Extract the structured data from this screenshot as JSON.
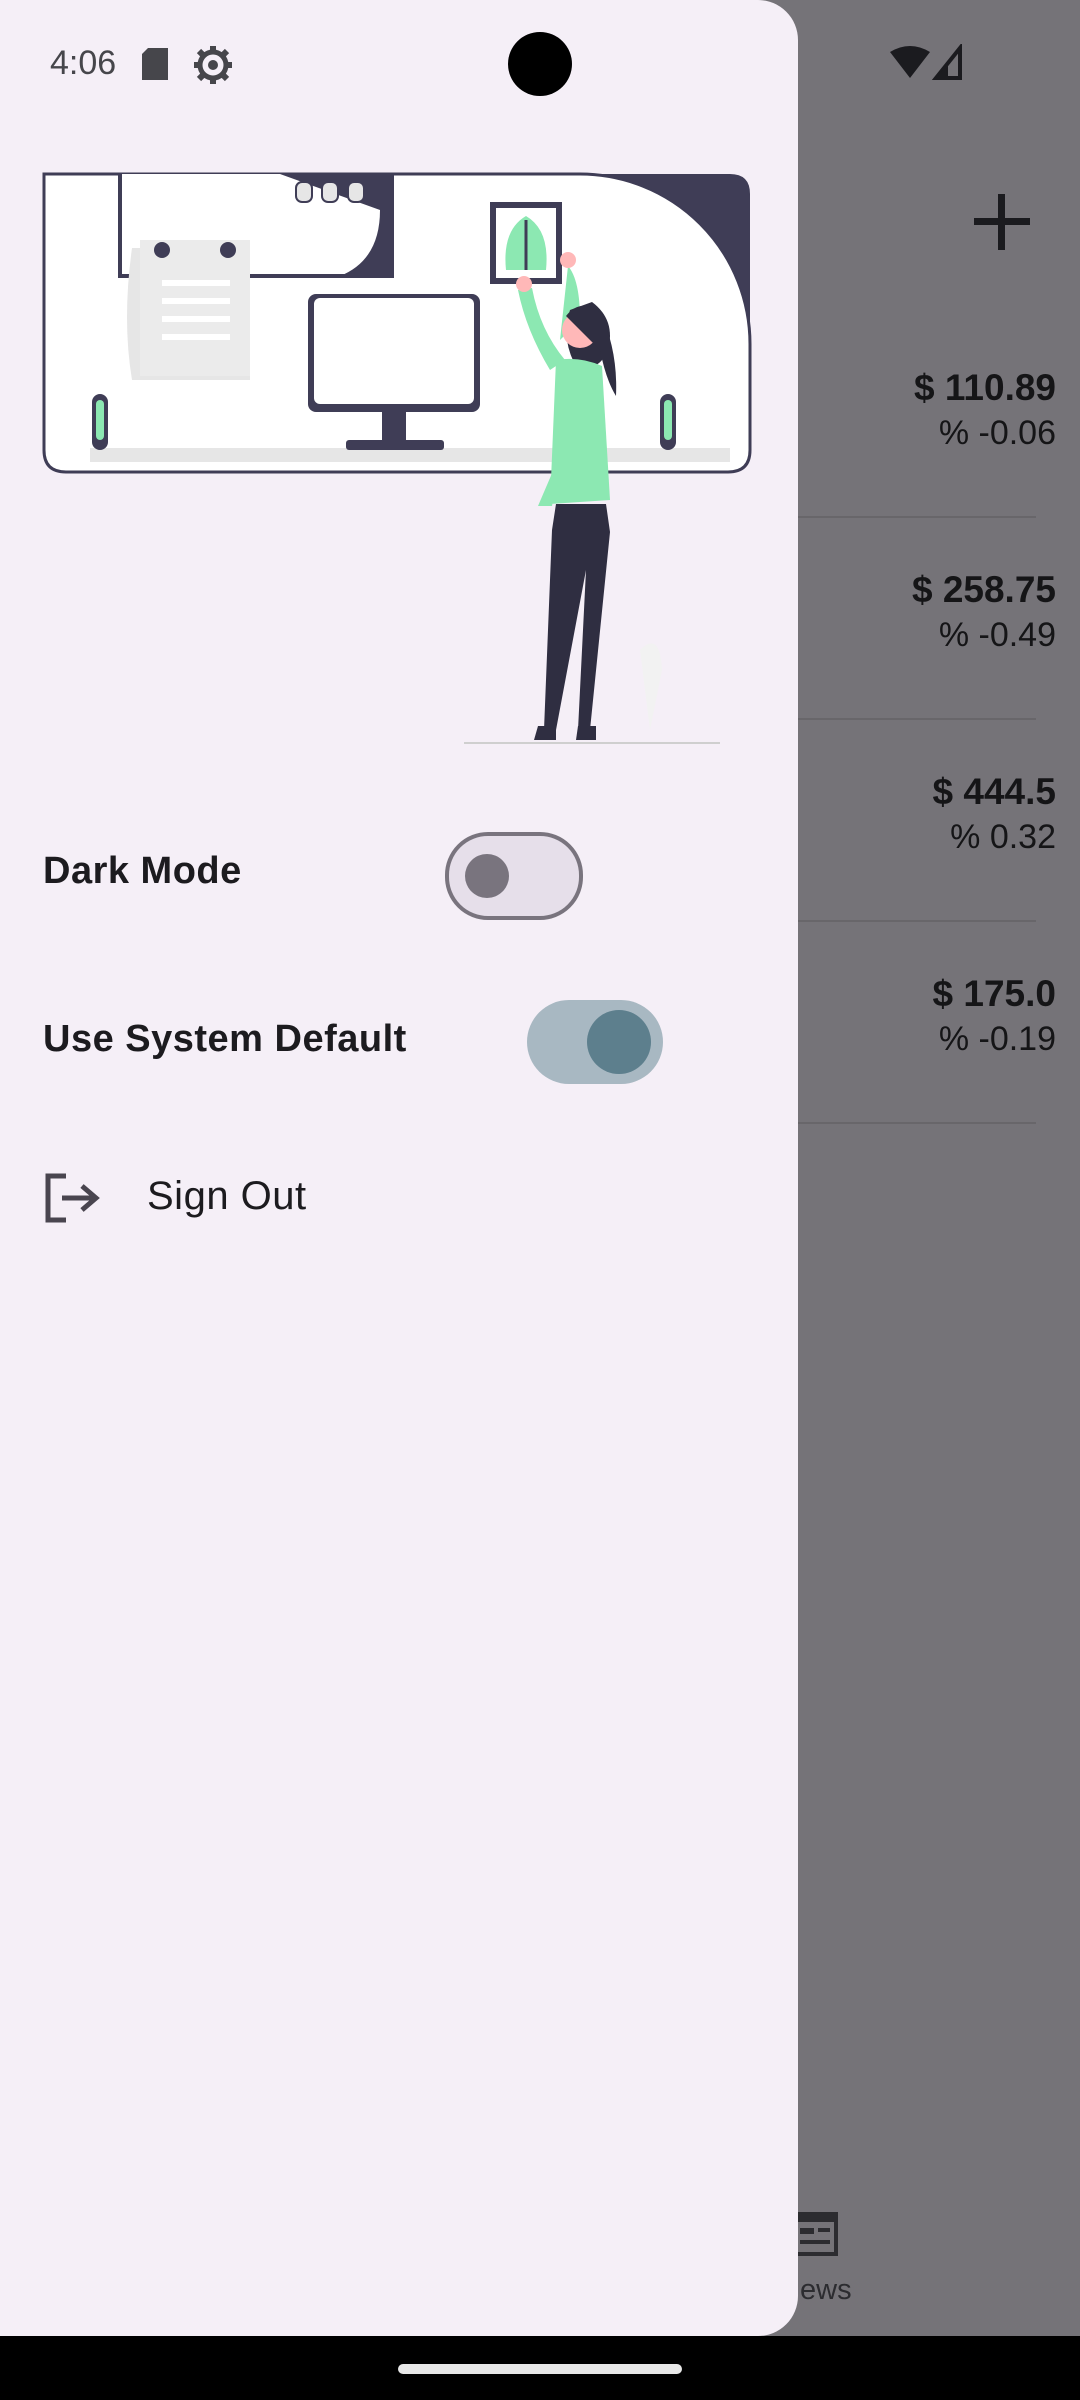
{
  "status_bar": {
    "time": "4:06"
  },
  "drawer": {
    "settings": [
      {
        "label": "Dark Mode",
        "enabled": false
      },
      {
        "label": "Use System Default",
        "enabled": true
      }
    ],
    "sign_out_label": "Sign Out"
  },
  "background": {
    "stocks": [
      {
        "price": "$ 110.89",
        "change": "% -0.06"
      },
      {
        "price": "$ 258.75",
        "change": "% -0.49"
      },
      {
        "price": "$ 444.5",
        "change": "% 0.32"
      },
      {
        "price": "$ 175.0",
        "change": "% -0.19"
      }
    ],
    "bottom_nav_partial_label": "ews"
  },
  "colors": {
    "drawer_bg": "#f5eff7",
    "scrim": "#757378",
    "accent_green": "#8ce8b2",
    "dark_navy": "#3f3d56"
  }
}
